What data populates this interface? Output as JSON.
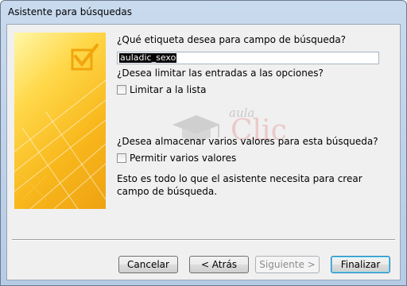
{
  "window": {
    "title": "Asistente para búsquedas"
  },
  "wizard": {
    "question_label": "¿Qué etiqueta desea para campo de búsqueda?",
    "label_value": "auladic_sexo",
    "limit_question": "¿Desea limitar las entradas a las opciones?",
    "limit_checkbox": {
      "label": "Limitar a la lista",
      "checked": false
    },
    "multi_question": "¿Desea almacenar varios valores para esta búsqueda?",
    "multi_checkbox": {
      "label": "Permitir varios valores",
      "checked": false
    },
    "finish_note": "Esto es todo lo que el asistente necesita para crear campo de búsqueda."
  },
  "watermark": {
    "aula": "aula",
    "clic": "Clic"
  },
  "buttons": {
    "cancel": "Cancelar",
    "back": "< Atrás",
    "next": "Siguiente >",
    "finish": "Finalizar"
  },
  "colors": {
    "accent": "#f8b81c",
    "default_button_border": "#3c7fb1"
  }
}
